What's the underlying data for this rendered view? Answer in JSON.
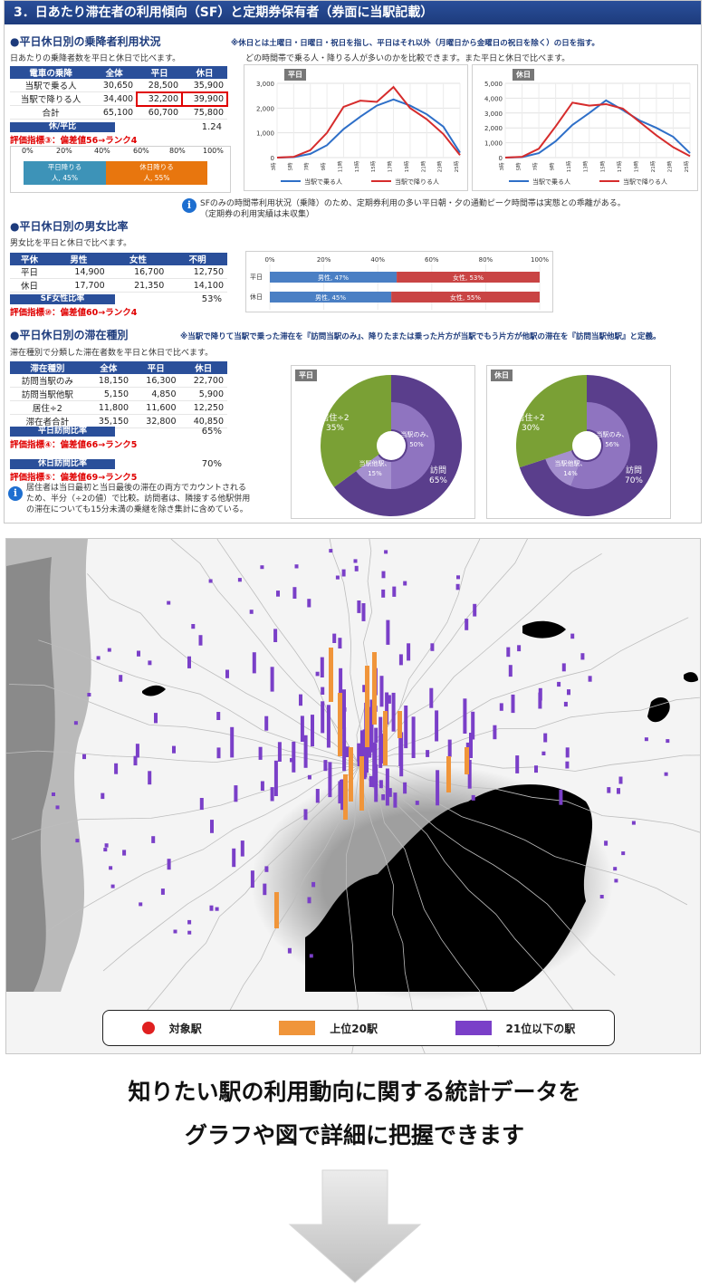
{
  "report": {
    "header": "3．日あたり滞在者の利用傾向（SF）と定期券保有者（券面に当駅記載）",
    "s1": {
      "title": "●平日休日別の乗降者利用状況",
      "note": "※休日とは土曜日・日曜日・祝日を指し、平日はそれ以外（月曜日から金曜日の祝日を除く）の日を指す。",
      "desc": "日あたりの乗降者数を平日と休日で比べます。",
      "desc2": "どの時間帯で乗る人・降りる人が多いのかを比較できます。また平日と休日で比べます。",
      "table": {
        "headers": [
          "電車の乗降",
          "全体",
          "平日",
          "休日"
        ],
        "rows": [
          [
            "当駅で乗る人",
            "30,650",
            "28,500",
            "35,900"
          ],
          [
            "当駅で降りる人",
            "34,400",
            "32,200",
            "39,900"
          ],
          [
            "合計",
            "65,100",
            "60,700",
            "75,800"
          ]
        ]
      },
      "ratio_label": "休/平比",
      "ratio_value": "1.24",
      "eval": "評価指標③：偏差値56→ランク4",
      "bar_axis": [
        "0%",
        "20%",
        "40%",
        "60%",
        "80%",
        "100%"
      ],
      "bar_left": "平日降りる\n人, 45%",
      "bar_right": "休日降りる\n人, 55%",
      "bar_left_l1": "平日降りる",
      "bar_left_l2": "人, 45%",
      "bar_right_l1": "休日降りる",
      "bar_right_l2": "人, 55%"
    },
    "info1_l1": "SFのみの時間帯利用状況（乗降）のため、定期券利用の多い平日朝・夕の通勤ピーク時間帯は実態との乖離がある。",
    "info1_l2": "（定期券の利用実績は未収集）",
    "s2": {
      "title": "●平日休日別の男女比率",
      "desc": "男女比を平日と休日で比べます。",
      "table": {
        "headers": [
          "平休",
          "男性",
          "女性",
          "不明"
        ],
        "rows": [
          [
            "平日",
            "14,900",
            "16,700",
            "12,750"
          ],
          [
            "休日",
            "17,700",
            "21,350",
            "14,100"
          ]
        ]
      },
      "ratio_label": "SF女性比率",
      "ratio_value": "53%",
      "eval": "評価指標⑩：偏差値60→ランク4"
    },
    "s3": {
      "title": "●平日休日別の滞在種別",
      "note": "※当駅で降りて当駅で乗った滞在を『訪問当駅のみ』、降りたまたは乗った片方が当駅でもう片方が他駅の滞在を『訪問当駅他駅』と定義。",
      "desc": "滞在種別で分類した滞在者数を平日と休日で比べます。",
      "table": {
        "headers": [
          "滞在種別",
          "全体",
          "平日",
          "休日"
        ],
        "rows": [
          [
            "訪問当駅のみ",
            "18,150",
            "16,300",
            "22,700"
          ],
          [
            "訪問当駅他駅",
            "5,150",
            "4,850",
            "5,900"
          ],
          [
            "居住÷2",
            "11,800",
            "11,600",
            "12,250"
          ],
          [
            "滞在者合計",
            "35,150",
            "32,800",
            "40,850"
          ]
        ]
      },
      "wk_ratio_label": "平日訪問比率",
      "wk_ratio_value": "65%",
      "wk_eval": "評価指標④：偏差値66→ランク5",
      "hd_ratio_label": "休日訪問比率",
      "hd_ratio_value": "70%",
      "hd_eval": "評価指標⑤：偏差値69→ランク5",
      "info_l1": "居住者は当日最初と当日最後の滞在の両方でカウントされる",
      "info_l2": "ため、半分（÷2の値）で比較。訪問者は、隣接する他駅併用",
      "info_l3": "の滞在についても15分未満の乗継を除き集計に含めている。"
    }
  },
  "chart_data": [
    {
      "type": "line",
      "title": "平日",
      "x": [
        "3時",
        "5時",
        "7時",
        "9時",
        "11時",
        "13時",
        "15時",
        "17時",
        "19時",
        "21時",
        "23時",
        "25時"
      ],
      "ylim": [
        0,
        3000
      ],
      "yticks": [
        "0",
        "1,000",
        "2,000",
        "3,000"
      ],
      "series": [
        {
          "name": "当駅で乗る人",
          "color": "#2e6fc8",
          "values": [
            0,
            20,
            150,
            500,
            1150,
            1650,
            2100,
            2350,
            2100,
            1750,
            1250,
            200
          ]
        },
        {
          "name": "当駅で降りる人",
          "color": "#d62c2c",
          "values": [
            0,
            30,
            300,
            1000,
            2050,
            2300,
            2250,
            2850,
            2000,
            1550,
            950,
            100
          ]
        }
      ]
    },
    {
      "type": "line",
      "title": "休日",
      "x": [
        "3時",
        "5時",
        "7時",
        "9時",
        "11時",
        "13時",
        "15時",
        "17時",
        "19時",
        "21時",
        "23時",
        "25時"
      ],
      "ylim": [
        0,
        5000
      ],
      "yticks": [
        "0",
        "1,000",
        "2,000",
        "3,000",
        "4,000",
        "5,000"
      ],
      "series": [
        {
          "name": "当駅で乗る人",
          "color": "#2e6fc8",
          "values": [
            0,
            30,
            300,
            1100,
            2200,
            3000,
            3850,
            3200,
            2500,
            2000,
            1400,
            300
          ]
        },
        {
          "name": "当駅で降りる人",
          "color": "#d62c2c",
          "values": [
            0,
            50,
            600,
            2100,
            3700,
            3500,
            3600,
            3300,
            2400,
            1500,
            700,
            100
          ]
        }
      ]
    },
    {
      "type": "bar",
      "title": "",
      "categories": [
        "平日",
        "休日"
      ],
      "axis": [
        "0%",
        "20%",
        "40%",
        "60%",
        "80%",
        "100%"
      ],
      "series": [
        {
          "name": "男性",
          "color": "#4a7fc4",
          "values": [
            47,
            45
          ],
          "labels": [
            "男性, 47%",
            "男性, 45%"
          ]
        },
        {
          "name": "女性",
          "color": "#c94444",
          "values": [
            53,
            55
          ],
          "labels": [
            "女性, 53%",
            "女性, 55%"
          ]
        }
      ]
    },
    {
      "type": "pie",
      "title": "平日",
      "slices": [
        {
          "label": "訪問\n65%",
          "value": 65,
          "color": "#5a3e8c"
        },
        {
          "label": "居住÷2\n35%",
          "value": 35,
          "color": "#7aa035"
        }
      ],
      "inner": [
        {
          "label": "当駅のみ、\n50%",
          "value": 50,
          "color": "#8f74c0"
        },
        {
          "label": "当駅他駅、\n15%",
          "value": 15,
          "color": "#a590cf"
        }
      ]
    },
    {
      "type": "pie",
      "title": "休日",
      "slices": [
        {
          "label": "訪問\n70%",
          "value": 70,
          "color": "#5a3e8c"
        },
        {
          "label": "居住÷2\n30%",
          "value": 30,
          "color": "#7aa035"
        }
      ],
      "inner": [
        {
          "label": "当駅のみ、\n56%",
          "value": 56,
          "color": "#8f74c0"
        },
        {
          "label": "当駅他駅、\n14%",
          "value": 14,
          "color": "#a590cf"
        }
      ]
    }
  ],
  "map": {
    "legend": [
      {
        "label": "対象駅",
        "color": "#e02020",
        "shape": "circle"
      },
      {
        "label": "上位20駅",
        "color": "#f0953a",
        "shape": "square"
      },
      {
        "label": "21位以下の駅",
        "color": "#7a3fc8",
        "shape": "square"
      }
    ]
  },
  "caption": {
    "line1": "知りたい駅の利用動向に関する統計データを",
    "line2": "グラフや図で詳細に把握できます"
  }
}
